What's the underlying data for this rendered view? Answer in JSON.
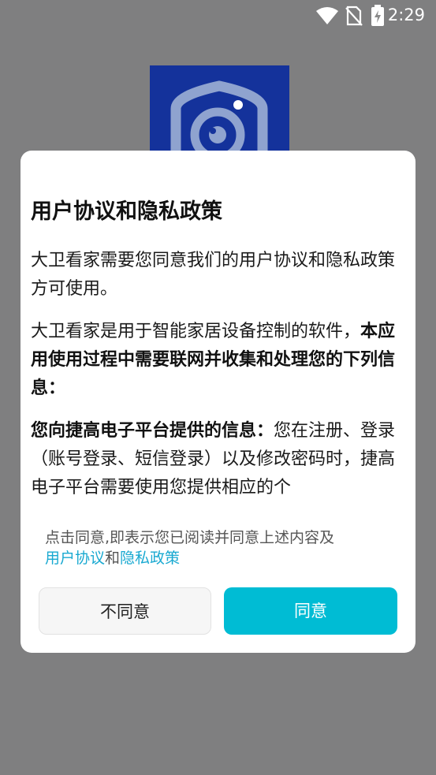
{
  "status_bar": {
    "time": "2:29",
    "icons": [
      "wifi-icon",
      "no-sim-icon",
      "battery-charging-icon"
    ]
  },
  "background": {
    "logo_icon": "camera-shield-icon",
    "logo_color": "#14329b"
  },
  "dialog": {
    "title": "用户协议和隐私政策",
    "intro": "大卫看家需要您同意我们的用户协议和隐私政策方可使用。",
    "para2_normal": "大卫看家是用于智能家居设备控制的软件，",
    "para2_bold": "本应用使用过程中需要联网并收集和处理您的下列信息：",
    "para3_bold": "您向捷高电子平台提供的信息：",
    "para3_normal": "您在注册、登录（账号登录、短信登录）以及修改密码时，捷高电子平台需要使用您提供相应的个",
    "consent_prefix": "点击同意,即表示您已阅读并同意上述内容及",
    "user_agreement_link": "用户协议",
    "conjunction": "和",
    "privacy_policy_link": "隐私政策",
    "disagree_button": "不同意",
    "agree_button": "同意"
  },
  "colors": {
    "accent": "#00bcd4",
    "link": "#19a9d1",
    "overlay": "#7f7f80"
  }
}
